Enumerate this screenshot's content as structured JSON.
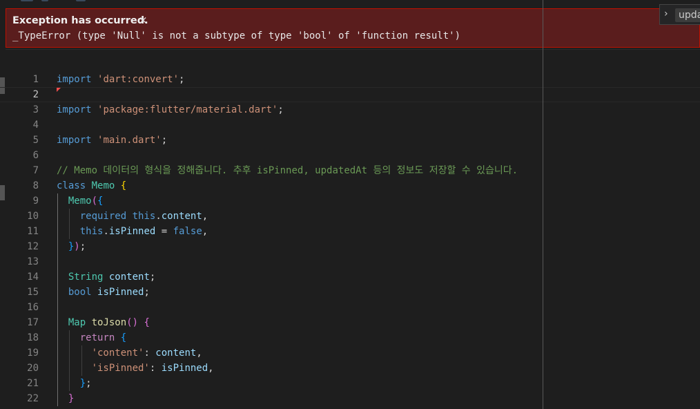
{
  "exception": {
    "title": "Exception has occurred.",
    "close_glyph": "×",
    "message": "_TypeError (type 'Null' is not a subtype of type 'bool' of 'function result')"
  },
  "peek_widget": {
    "chevron": "›",
    "text": "upda"
  },
  "editor": {
    "current_line": 2,
    "lines": [
      {
        "n": "1",
        "tokens": [
          [
            "kw",
            "import"
          ],
          [
            "pl",
            " "
          ],
          [
            "str",
            "'dart:convert'"
          ],
          [
            "pl",
            ";"
          ]
        ]
      },
      {
        "n": "2",
        "tokens": []
      },
      {
        "n": "3",
        "tokens": [
          [
            "kw",
            "import"
          ],
          [
            "pl",
            " "
          ],
          [
            "str",
            "'package:flutter/material.dart'"
          ],
          [
            "pl",
            ";"
          ]
        ]
      },
      {
        "n": "4",
        "tokens": []
      },
      {
        "n": "5",
        "tokens": [
          [
            "kw",
            "import"
          ],
          [
            "pl",
            " "
          ],
          [
            "str",
            "'main.dart'"
          ],
          [
            "pl",
            ";"
          ]
        ]
      },
      {
        "n": "6",
        "tokens": []
      },
      {
        "n": "7",
        "tokens": [
          [
            "cmt",
            "// Memo 데이터의 형식을 정해줍니다. 추후 isPinned, updatedAt 등의 정보도 저장할 수 있습니다."
          ]
        ]
      },
      {
        "n": "8",
        "tokens": [
          [
            "kw",
            "class"
          ],
          [
            "pl",
            " "
          ],
          [
            "typ",
            "Memo"
          ],
          [
            "pl",
            " "
          ],
          [
            "br1",
            "{"
          ]
        ]
      },
      {
        "n": "9",
        "tokens": [
          [
            "pl",
            "  "
          ],
          [
            "typ",
            "Memo"
          ],
          [
            "br2",
            "("
          ],
          [
            "br3",
            "{"
          ]
        ]
      },
      {
        "n": "10",
        "tokens": [
          [
            "pl",
            "    "
          ],
          [
            "kw",
            "required"
          ],
          [
            "pl",
            " "
          ],
          [
            "kw",
            "this"
          ],
          [
            "pl",
            "."
          ],
          [
            "var",
            "content"
          ],
          [
            "pl",
            ","
          ]
        ]
      },
      {
        "n": "11",
        "tokens": [
          [
            "pl",
            "    "
          ],
          [
            "kw",
            "this"
          ],
          [
            "pl",
            "."
          ],
          [
            "var",
            "isPinned"
          ],
          [
            "pl",
            " = "
          ],
          [
            "kw",
            "false"
          ],
          [
            "pl",
            ","
          ]
        ]
      },
      {
        "n": "12",
        "tokens": [
          [
            "pl",
            "  "
          ],
          [
            "br3",
            "}"
          ],
          [
            "br2",
            ")"
          ],
          [
            "pl",
            ";"
          ]
        ]
      },
      {
        "n": "13",
        "tokens": []
      },
      {
        "n": "14",
        "tokens": [
          [
            "pl",
            "  "
          ],
          [
            "typ",
            "String"
          ],
          [
            "pl",
            " "
          ],
          [
            "var",
            "content"
          ],
          [
            "pl",
            ";"
          ]
        ]
      },
      {
        "n": "15",
        "tokens": [
          [
            "pl",
            "  "
          ],
          [
            "kw",
            "bool"
          ],
          [
            "pl",
            " "
          ],
          [
            "var",
            "isPinned"
          ],
          [
            "pl",
            ";"
          ]
        ]
      },
      {
        "n": "16",
        "tokens": []
      },
      {
        "n": "17",
        "tokens": [
          [
            "pl",
            "  "
          ],
          [
            "typ",
            "Map"
          ],
          [
            "pl",
            " "
          ],
          [
            "fn",
            "toJson"
          ],
          [
            "br2",
            "()"
          ],
          [
            "pl",
            " "
          ],
          [
            "br2",
            "{"
          ]
        ]
      },
      {
        "n": "18",
        "tokens": [
          [
            "pl",
            "    "
          ],
          [
            "ctrl",
            "return"
          ],
          [
            "pl",
            " "
          ],
          [
            "br3",
            "{"
          ]
        ]
      },
      {
        "n": "19",
        "tokens": [
          [
            "pl",
            "      "
          ],
          [
            "str",
            "'content'"
          ],
          [
            "pl",
            ": "
          ],
          [
            "var",
            "content"
          ],
          [
            "pl",
            ","
          ]
        ]
      },
      {
        "n": "20",
        "tokens": [
          [
            "pl",
            "      "
          ],
          [
            "str",
            "'isPinned'"
          ],
          [
            "pl",
            ": "
          ],
          [
            "var",
            "isPinned"
          ],
          [
            "pl",
            ","
          ]
        ]
      },
      {
        "n": "21",
        "tokens": [
          [
            "pl",
            "    "
          ],
          [
            "br3",
            "}"
          ],
          [
            "pl",
            ";"
          ]
        ]
      },
      {
        "n": "22",
        "tokens": [
          [
            "pl",
            "  "
          ],
          [
            "br2",
            "}"
          ]
        ]
      }
    ]
  }
}
